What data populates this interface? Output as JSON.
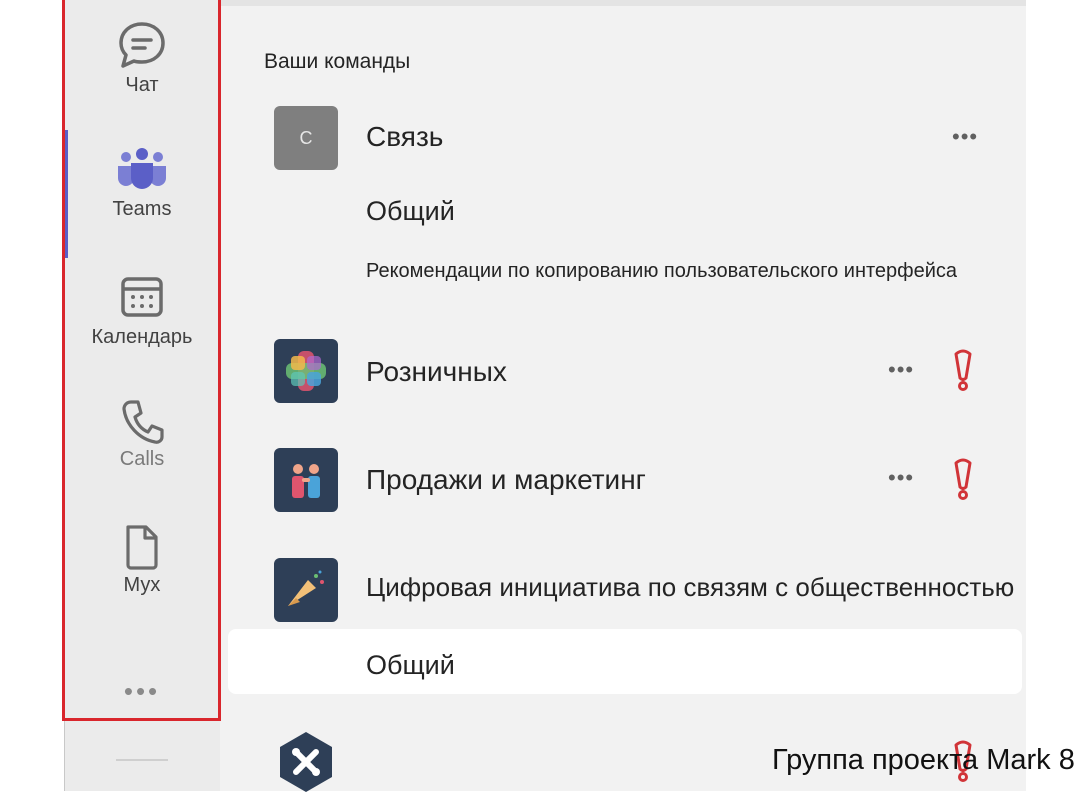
{
  "rail": {
    "items": [
      {
        "label": "Чат",
        "icon": "chat-icon"
      },
      {
        "label": "Teams",
        "icon": "teams-icon"
      },
      {
        "label": "Календарь",
        "icon": "calendar-icon"
      },
      {
        "label": "Calls",
        "icon": "phone-icon"
      },
      {
        "label": "Мух",
        "icon": "file-icon"
      }
    ],
    "more": "•••",
    "active_color": "#5b5fc7",
    "highlight_color": "#d9262c"
  },
  "panel": {
    "section_title": "Ваши команды",
    "teams": [
      {
        "name": "Связь",
        "avatar_letter": "C",
        "avatar_color": "#7f7f7f",
        "more": "•••",
        "channels": [
          "Общий"
        ],
        "sub_items": [
          "Рекомендации по копированию пользовательского интерфейса"
        ]
      },
      {
        "name": "Розничных",
        "avatar_color": "#2e3f57",
        "more": "•••",
        "alert_icon": "exclamation-icon"
      },
      {
        "name": "Продажи и маркетинг",
        "avatar_color": "#2e3f57",
        "more": "•••",
        "alert_icon": "exclamation-icon"
      },
      {
        "name": "Цифровая инициатива по связям с общественностью",
        "avatar_color": "#2e3f57",
        "channels": [
          "Общий"
        ]
      },
      {
        "name": "",
        "avatar_color": "#2e3f57",
        "alert_icon": "exclamation-icon"
      }
    ]
  },
  "overlay_caption": "Группа проекта Mark 8",
  "colors": {
    "alert": "#d13438",
    "rail_bg": "#ebebeb",
    "panel_bg": "#f2f2f2"
  }
}
